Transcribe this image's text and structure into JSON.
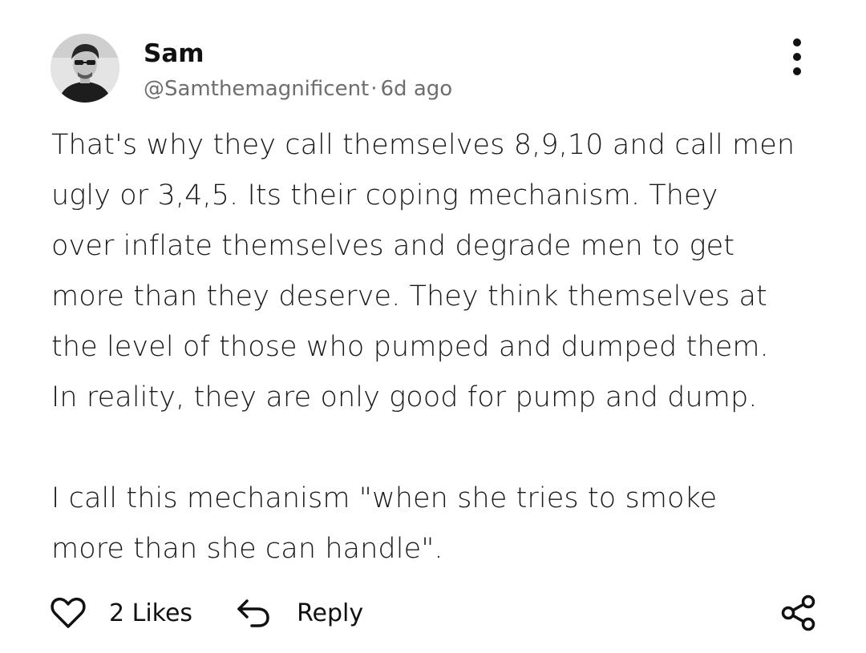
{
  "post": {
    "author_name": "Sam",
    "author_handle": "@Samthemagnificent",
    "separator": "·",
    "time_ago": "6d ago",
    "avatar_icon": "user-avatar-photo",
    "more_icon": "more-vertical-icon",
    "body": {
      "lines": [
        "That's why they call themselves 8,9,10 and call men",
        "ugly or 3,4,5. Its their coping mechanism. They",
        "over inflate themselves and degrade men to get",
        "more than they deserve. They think themselves at",
        "the level of those who pumped and dumped them.",
        "In reality, they are only good for pump and dump."
      ],
      "lines2": [
        "I call this mechanism \"when she tries to smoke",
        "more than she can handle\"."
      ]
    }
  },
  "actions": {
    "like_icon": "heart-icon",
    "likes_label": "2 Likes",
    "reply_icon": "reply-arrow-icon",
    "reply_label": "Reply",
    "share_icon": "share-icon"
  },
  "colors": {
    "text": "#1a1a1a",
    "meta": "#6e6e6e",
    "background": "#ffffff"
  }
}
